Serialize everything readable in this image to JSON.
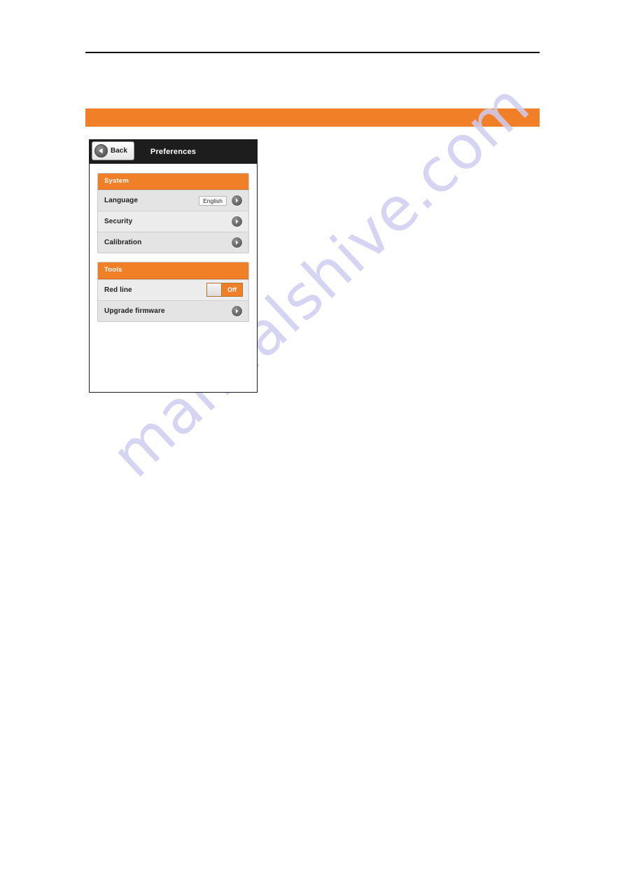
{
  "page": {
    "banner_text": "",
    "watermark": "manualshive.com"
  },
  "device": {
    "titlebar": {
      "back_label": "Back",
      "back_icon": "arrow-left-circle-icon",
      "title": "Preferences"
    },
    "groups": [
      {
        "header": "System",
        "rows": [
          {
            "label": "Language",
            "value": "English",
            "accessory": "chevron-right-icon"
          },
          {
            "label": "Security",
            "value": "",
            "accessory": "chevron-right-icon"
          },
          {
            "label": "Calibration",
            "value": "",
            "accessory": "chevron-right-icon"
          }
        ]
      },
      {
        "header": "Tools",
        "rows": [
          {
            "label": "Red line",
            "value": "Off",
            "accessory": "toggle-switch"
          },
          {
            "label": "Upgrade firmware",
            "value": "",
            "accessory": "chevron-right-icon"
          }
        ]
      }
    ]
  },
  "colors": {
    "accent_orange": "#f07f27",
    "titlebar_black": "#1d1d1d",
    "row_gray": "#e4e4e4",
    "row_gray_alt": "#ececec",
    "watermark_lavender": "#cfcdf2"
  }
}
